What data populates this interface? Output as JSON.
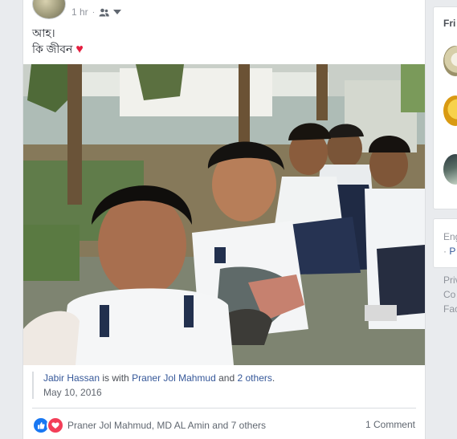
{
  "post": {
    "time": "1 hr",
    "separator": "·",
    "text_line1": "আহ।",
    "text_line2": "কি জীবন",
    "heart": "♥",
    "share": {
      "author": "Jabir Hassan",
      "is_with": "is with",
      "with_name": "Praner Jol Mahmud",
      "and_text": "and",
      "others": "2 others",
      "period": ".",
      "date": "May 10, 2016"
    },
    "reactions": {
      "names": "Praner Jol Mahmud, MD AL Amin and 7 others",
      "comments": "1 Comment"
    }
  },
  "right_column": {
    "friends_title": "Fri",
    "engagement_line1": "Eng",
    "engagement_line2_sep": "·",
    "engagement_line2_link": "P",
    "footer_line1": "Priv",
    "footer_line2": "Co",
    "footer_line3": "Fac"
  },
  "colors": {
    "link": "#365899",
    "like": "#1877f2",
    "love": "#f33e58",
    "page_bg": "#e9ebee"
  }
}
